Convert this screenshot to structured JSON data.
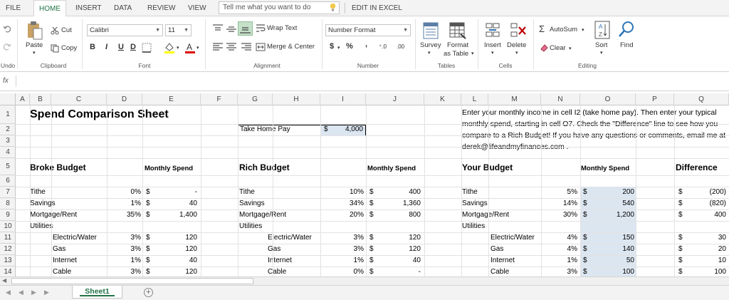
{
  "tabs": [
    {
      "label": "FILE"
    },
    {
      "label": "HOME"
    },
    {
      "label": "INSERT"
    },
    {
      "label": "DATA"
    },
    {
      "label": "REVIEW"
    },
    {
      "label": "VIEW"
    }
  ],
  "tell_me": {
    "placeholder": "Tell me what you want to do"
  },
  "edit_in_excel": "EDIT IN EXCEL",
  "ribbon": {
    "undo": "Undo",
    "clipboard": {
      "paste": "Paste",
      "cut": "Cut",
      "copy": "Copy",
      "label": "Clipboard"
    },
    "font": {
      "name": "Calibri",
      "size": "11",
      "bold": "B",
      "italic": "I",
      "underline": "U",
      "double_underline": "D",
      "label": "Font"
    },
    "alignment": {
      "wrap": "Wrap Text",
      "merge": "Merge & Center",
      "label": "Alignment"
    },
    "number": {
      "format": "Number Format",
      "currency": "$",
      "percent": "%",
      "comma": ",",
      "inc_dec": "⁺.0",
      "dec_dec": ".00",
      "label": "Number"
    },
    "tables": {
      "survey": "Survey",
      "format_table_1": "Format",
      "format_table_2": "as Table",
      "label": "Tables"
    },
    "cells": {
      "insert": "Insert",
      "delete": "Delete",
      "label": "Cells"
    },
    "editing": {
      "autosum": "AutoSum",
      "clear": "Clear",
      "sort": "Sort",
      "find": "Find",
      "label": "Editing"
    }
  },
  "formula_bar": {
    "fx": "fx",
    "value": ""
  },
  "columns": [
    "A",
    "B",
    "C",
    "D",
    "E",
    "F",
    "G",
    "H",
    "I",
    "J",
    "K",
    "L",
    "M",
    "N",
    "O",
    "P",
    "Q"
  ],
  "rows": [
    "1",
    "2",
    "3",
    "4",
    "5",
    "6",
    "7",
    "8",
    "9",
    "10",
    "11",
    "12",
    "13",
    "14"
  ],
  "sheet": {
    "title": "Spend Comparison Sheet",
    "take_home": {
      "label": "Take Home Pay",
      "currency": "$",
      "value": "4,000"
    },
    "instructions": [
      "Enter your monthly income in cell I2 (take home pay). Then enter your typical",
      "monthly spend, starting in cell O7. Check the \"Difference\" line to see how you",
      "compare to a Rich Budget! If you have any questions or comments, email me at",
      "derek@lifeandmyfinances.com ."
    ],
    "broke_header": "Broke Budget",
    "rich_header": "Rich Budget",
    "your_header": "Your Budget",
    "monthly_spend": "Monthly Spend",
    "difference": "Difference",
    "currency": "$",
    "broke": [
      {
        "label": "Tithe",
        "indent": false,
        "pct": "0%",
        "amt": "-"
      },
      {
        "label": "Savings",
        "indent": false,
        "pct": "1%",
        "amt": "40"
      },
      {
        "label": "Mortgage/Rent",
        "indent": false,
        "pct": "35%",
        "amt": "1,400"
      },
      {
        "label": "Utilities",
        "indent": false,
        "pct": "",
        "amt": ""
      },
      {
        "label": "Electric/Water",
        "indent": true,
        "pct": "3%",
        "amt": "120"
      },
      {
        "label": "Gas",
        "indent": true,
        "pct": "3%",
        "amt": "120"
      },
      {
        "label": "Internet",
        "indent": true,
        "pct": "1%",
        "amt": "40"
      },
      {
        "label": "Cable",
        "indent": true,
        "pct": "3%",
        "amt": "120"
      }
    ],
    "rich": [
      {
        "label": "Tithe",
        "indent": false,
        "pct": "10%",
        "amt": "400"
      },
      {
        "label": "Savings",
        "indent": false,
        "pct": "34%",
        "amt": "1,360"
      },
      {
        "label": "Mortgage/Rent",
        "indent": false,
        "pct": "20%",
        "amt": "800"
      },
      {
        "label": "Utilities",
        "indent": false,
        "pct": "",
        "amt": ""
      },
      {
        "label": "Electric/Water",
        "indent": true,
        "pct": "3%",
        "amt": "120"
      },
      {
        "label": "Gas",
        "indent": true,
        "pct": "3%",
        "amt": "120"
      },
      {
        "label": "Internet",
        "indent": true,
        "pct": "1%",
        "amt": "40"
      },
      {
        "label": "Cable",
        "indent": true,
        "pct": "0%",
        "amt": "-"
      }
    ],
    "yours": [
      {
        "label": "Tithe",
        "indent": false,
        "pct": "5%",
        "amt": "200",
        "diff": "(200)"
      },
      {
        "label": "Savings",
        "indent": false,
        "pct": "14%",
        "amt": "540",
        "diff": "(820)"
      },
      {
        "label": "Mortgage/Rent",
        "indent": false,
        "pct": "30%",
        "amt": "1,200",
        "diff": "400"
      },
      {
        "label": "Utilities",
        "indent": false,
        "pct": "",
        "amt": "",
        "diff": ""
      },
      {
        "label": "Electric/Water",
        "indent": true,
        "pct": "4%",
        "amt": "150",
        "diff": "30"
      },
      {
        "label": "Gas",
        "indent": true,
        "pct": "4%",
        "amt": "140",
        "diff": "20"
      },
      {
        "label": "Internet",
        "indent": true,
        "pct": "1%",
        "amt": "50",
        "diff": "10"
      },
      {
        "label": "Cable",
        "indent": true,
        "pct": "3%",
        "amt": "100",
        "diff": "100"
      }
    ]
  },
  "sheet_tab": "Sheet1",
  "colors": {
    "accent": "#217346",
    "input_fill": "#dce6f1"
  }
}
